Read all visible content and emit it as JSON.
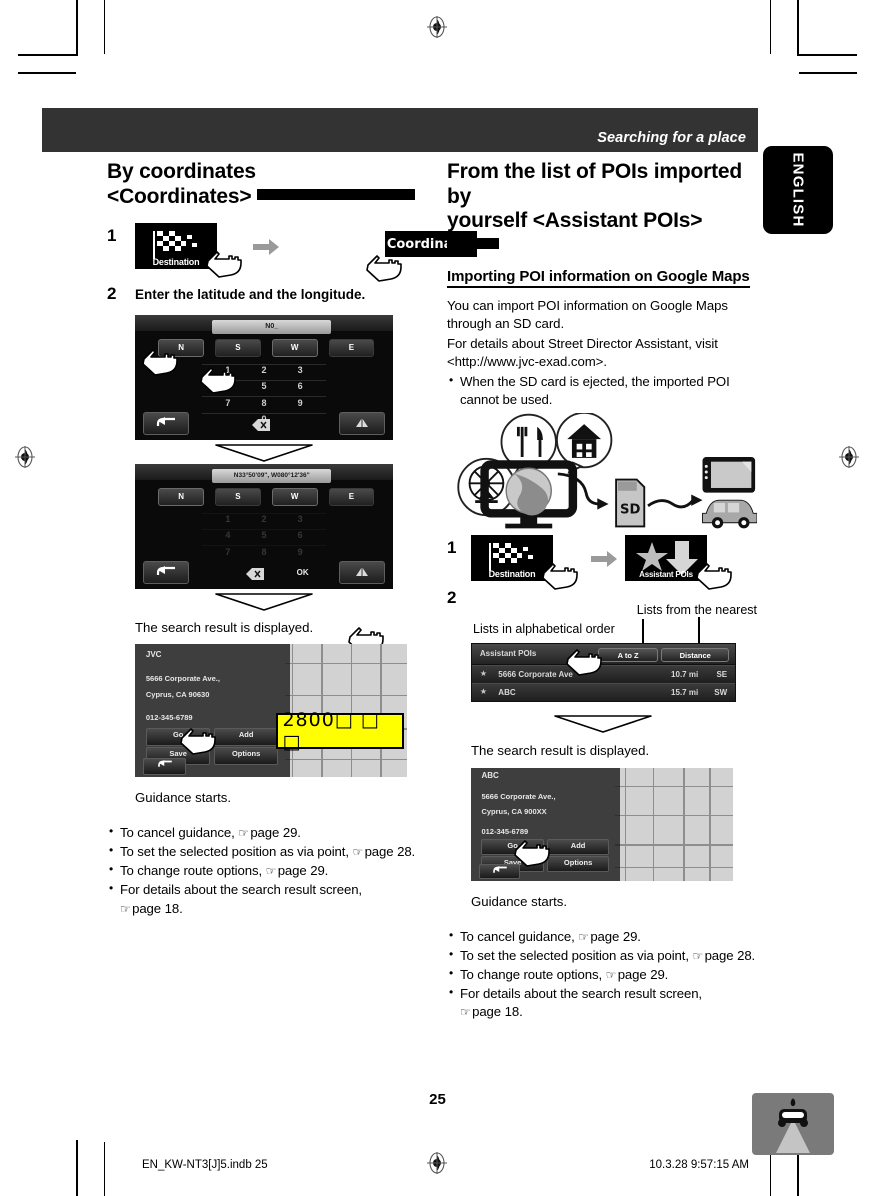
{
  "header": {
    "running_title": "Searching for a place",
    "language_tab": "ENGLISH"
  },
  "left_column": {
    "heading_line1": "By coordinates",
    "heading_line2": "<Coordinates>",
    "step1": {
      "number": "1"
    },
    "step1_tiles": {
      "destination_label": "Destination",
      "arrow": "right-arrow-icon",
      "coordinates_label": "Coordinates"
    },
    "step2": {
      "number": "2",
      "text": "Enter the latitude and the longitude."
    },
    "screen_keypad": {
      "entry_value": "N0_",
      "dir_buttons": [
        "N",
        "S",
        "W",
        "E"
      ],
      "keys": [
        "1",
        "2",
        "3",
        "4",
        "5",
        "6",
        "7",
        "8",
        "9",
        "0"
      ],
      "back_button": "back-arrow-icon",
      "clear_button": "clear-icon",
      "map_button": "map-icon"
    },
    "screen_keypad_filled": {
      "entry_value": "N33°50'09\", W080°12'36\"",
      "dir_buttons": [
        "N",
        "S",
        "W",
        "E"
      ],
      "ok_button": "OK",
      "back_button": "back-arrow-icon",
      "clear_button": "clear-icon",
      "map_button": "map-icon"
    },
    "result_caption": "The search result is displayed.",
    "map_screen": {
      "title": "JVC",
      "address_line1": "5666 Corporate Ave.,",
      "address_line2": "Cyprus, CA 90630",
      "phone": "012-345-6789",
      "go_button": "Go",
      "add_button": "Add",
      "save_button": "Save",
      "options_button": "Options",
      "back_button": "back-arrow-icon",
      "callout_text": "2800□ □ □"
    },
    "guidance_caption": "Guidance starts.",
    "bullets": [
      {
        "text": "To cancel guidance, ",
        "ref": "page 29."
      },
      {
        "text": "To set the selected position as via point, ",
        "ref": "page 28."
      },
      {
        "text": "To change route options, ",
        "ref": "page 29."
      },
      {
        "text": "For details about the search result screen,",
        "ref": ""
      },
      {
        "text": "",
        "ref": "page 18."
      }
    ]
  },
  "right_column": {
    "heading_line1": "From the list of POIs imported by",
    "heading_line2": "yourself <Assistant POIs>",
    "subheading": "Importing POI information on Google Maps",
    "paragraphs": [
      "You can import POI information on Google Maps through an SD card.",
      "For details about Street Director Assistant, visit <http://www.jvc-exad.com>."
    ],
    "note_bullet": "When the SD card is ejected, the imported POI cannot be used.",
    "diagram": {
      "poi_icons": [
        "ferris-wheel-icon",
        "restaurant-icon",
        "house-icon"
      ],
      "globe": "globe-icon",
      "monitor": "monitor-icon",
      "sd_card_label": "SD",
      "car_unit": "car-navigation-icon",
      "car": "car-icon"
    },
    "step1": {
      "number": "1"
    },
    "step1_tiles": {
      "destination_label": "Destination",
      "arrow": "right-arrow-icon",
      "assistant_label": "Assistant POIs"
    },
    "step2": {
      "number": "2"
    },
    "callout_alpha": "Lists in alphabetical order",
    "callout_nearest": "Lists from the nearest",
    "poi_list": {
      "title": "Assistant POIs",
      "sort_alpha_button": "A to Z",
      "sort_distance_button": "Distance",
      "rows": [
        {
          "name": "5666 Corporate Ave",
          "distance": "10.7 mi",
          "bearing": "SE"
        },
        {
          "name": "ABC",
          "distance": "15.7 mi",
          "bearing": "SW"
        }
      ]
    },
    "result_caption": "The search result is displayed.",
    "map_screen": {
      "title": "ABC",
      "address_line1": "5666 Corporate Ave.,",
      "address_line2": "Cyprus, CA 900XX",
      "phone": "012-345-6789",
      "go_button": "Go",
      "add_button": "Add",
      "save_button": "Save",
      "options_button": "Options",
      "back_button": "back-arrow-icon"
    },
    "guidance_caption": "Guidance starts.",
    "bullets": [
      {
        "text": "To cancel guidance, ",
        "ref": "page 29."
      },
      {
        "text": "To set the selected position as via point, ",
        "ref": "page 28."
      },
      {
        "text": "To change route options, ",
        "ref": "page 29."
      },
      {
        "text": "For details about the search result screen,",
        "ref": ""
      },
      {
        "text": "",
        "ref": "page 18."
      }
    ]
  },
  "footer": {
    "page_number": "25",
    "file_info": "EN_KW-NT3[J]5.indb   25",
    "time_info": "10.3.28   9:57:15 AM"
  },
  "colors": {
    "header_bg": "#333333",
    "black": "#000000",
    "highlight_yellow": "#ffff00",
    "grey_arrow": "#9a9a9a"
  }
}
